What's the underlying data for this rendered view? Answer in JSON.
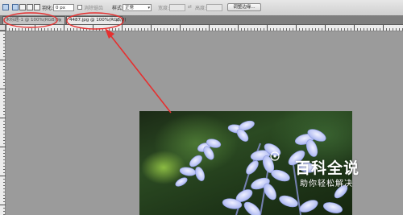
{
  "options_bar": {
    "feather_label": "羽化:",
    "feather_value": "0 px",
    "antialias_label": "消除锯齿",
    "style_label": "样式:",
    "style_value": "正常",
    "width_label": "宽度:",
    "height_label": "高度:",
    "refine_edge_label": "调整边缘..."
  },
  "tabs": [
    {
      "label": "未标题-1 @ 100%(RGB/8)",
      "close": "×",
      "active": false
    },
    {
      "label": "4487.jpg @ 100%(RGB/8)",
      "close": "×",
      "active": true
    }
  ],
  "annotation_color": "#e53030",
  "watermark": {
    "title": "百科全说",
    "subtitle": "助你轻松解决"
  },
  "icons": {
    "tool": "rect-marquee-icon",
    "modes": [
      "new-selection-icon",
      "add-selection-icon",
      "subtract-selection-icon",
      "intersect-selection-icon"
    ]
  }
}
